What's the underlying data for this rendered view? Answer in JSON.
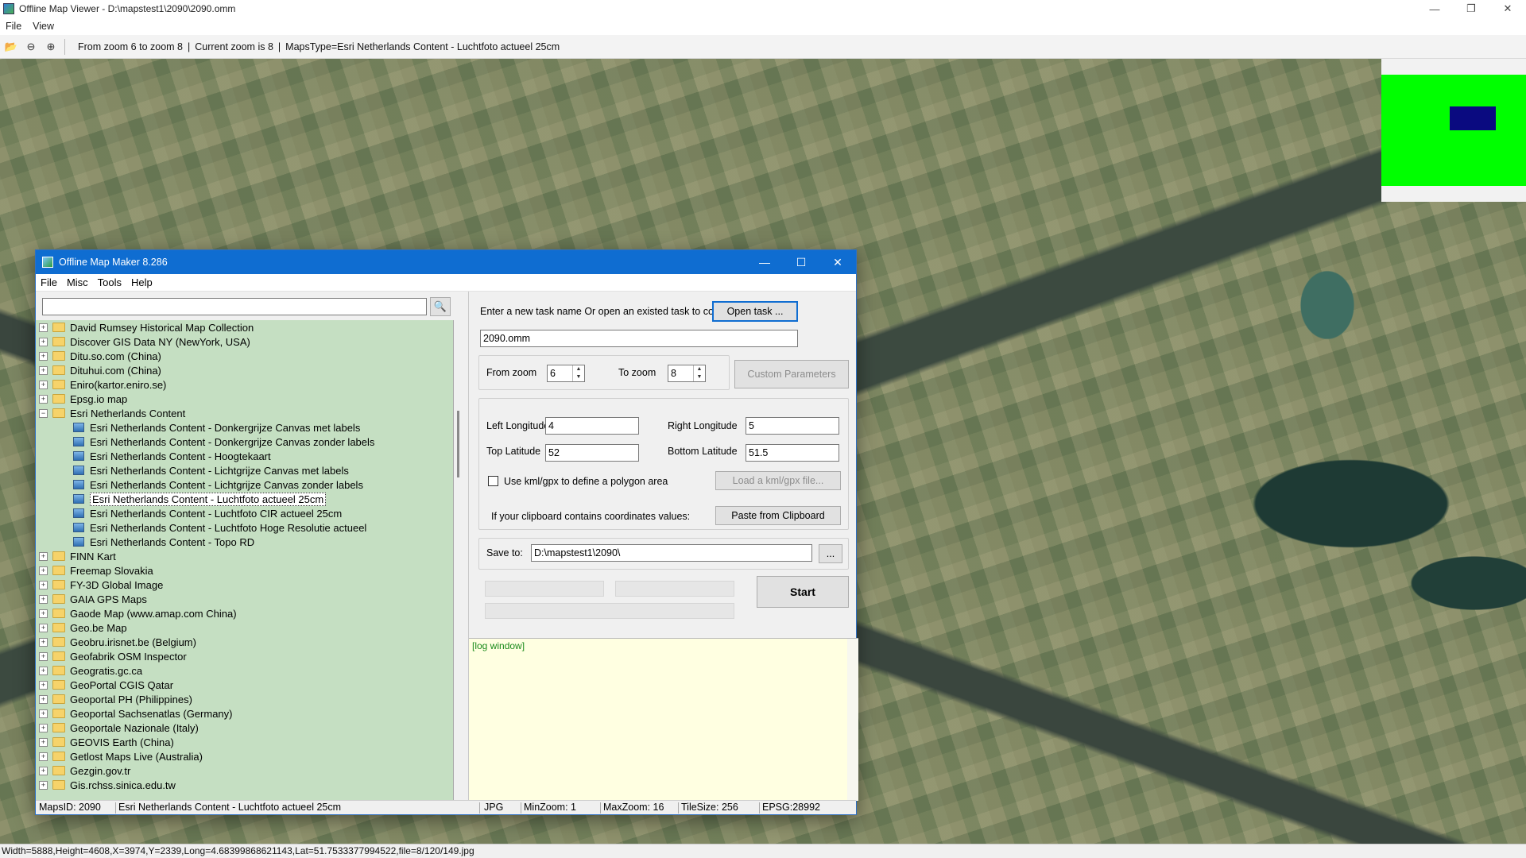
{
  "viewer": {
    "title": "Offline Map Viewer - D:\\mapstest1\\2090\\2090.omm",
    "menu": [
      "File",
      "View"
    ],
    "toolbar_info": {
      "zoom_range": "From zoom 6 to zoom 8",
      "current_zoom": "Current zoom is 8",
      "maps_type": "MapsType=Esri Netherlands Content - Luchtfoto actueel 25cm"
    },
    "status": "Width=5888,Height=4608,X=3974,Y=2339,Long=4.68399868621143,Lat=51.7533377994522,file=8/120/149.jpg",
    "minimap_colors": {
      "overview": "#00ff00",
      "viewport": "#0a0a80"
    }
  },
  "dialog": {
    "title": "Offline Map Maker 8.286",
    "menu": [
      "File",
      "Misc",
      "Tools",
      "Help"
    ],
    "search_value": "",
    "tree": [
      {
        "label": "David Rumsey Historical Map Collection",
        "type": "folder",
        "expanded": false
      },
      {
        "label": "Discover GIS Data NY (NewYork, USA)",
        "type": "folder",
        "expanded": false
      },
      {
        "label": "Ditu.so.com (China)",
        "type": "folder",
        "expanded": false
      },
      {
        "label": "Dituhui.com (China)",
        "type": "folder",
        "expanded": false
      },
      {
        "label": "Eniro(kartor.eniro.se)",
        "type": "folder",
        "expanded": false
      },
      {
        "label": "Epsg.io map",
        "type": "folder",
        "expanded": false
      },
      {
        "label": "Esri Netherlands Content",
        "type": "folder",
        "expanded": true
      },
      {
        "label": "Esri Netherlands Content - Donkergrijze Canvas met labels",
        "type": "map"
      },
      {
        "label": "Esri Netherlands Content - Donkergrijze Canvas zonder labels",
        "type": "map"
      },
      {
        "label": "Esri Netherlands Content - Hoogtekaart",
        "type": "map"
      },
      {
        "label": "Esri Netherlands Content - Lichtgrijze Canvas met labels",
        "type": "map"
      },
      {
        "label": "Esri Netherlands Content - Lichtgrijze Canvas zonder labels",
        "type": "map"
      },
      {
        "label": "Esri Netherlands Content - Luchtfoto actueel 25cm",
        "type": "map",
        "selected": true
      },
      {
        "label": "Esri Netherlands Content - Luchtfoto CIR actueel 25cm",
        "type": "map"
      },
      {
        "label": "Esri Netherlands Content - Luchtfoto Hoge Resolutie actueel",
        "type": "map"
      },
      {
        "label": "Esri Netherlands Content - Topo RD",
        "type": "map"
      },
      {
        "label": "FINN Kart",
        "type": "folder",
        "expanded": false
      },
      {
        "label": "Freemap Slovakia",
        "type": "folder",
        "expanded": false
      },
      {
        "label": "FY-3D Global Image",
        "type": "folder",
        "expanded": false
      },
      {
        "label": "GAIA GPS Maps",
        "type": "folder",
        "expanded": false
      },
      {
        "label": "Gaode Map (www.amap.com China)",
        "type": "folder",
        "expanded": false
      },
      {
        "label": "Geo.be Map",
        "type": "folder",
        "expanded": false
      },
      {
        "label": "Geobru.irisnet.be (Belgium)",
        "type": "folder",
        "expanded": false
      },
      {
        "label": "Geofabrik OSM Inspector",
        "type": "folder",
        "expanded": false
      },
      {
        "label": "Geogratis.gc.ca",
        "type": "folder",
        "expanded": false
      },
      {
        "label": "GeoPortal CGIS Qatar",
        "type": "folder",
        "expanded": false
      },
      {
        "label": "Geoportal PH (Philippines)",
        "type": "folder",
        "expanded": false
      },
      {
        "label": "Geoportal Sachsenatlas (Germany)",
        "type": "folder",
        "expanded": false
      },
      {
        "label": "Geoportale Nazionale (Italy)",
        "type": "folder",
        "expanded": false
      },
      {
        "label": "GEOVIS Earth (China)",
        "type": "folder",
        "expanded": false
      },
      {
        "label": "Getlost Maps Live (Australia)",
        "type": "folder",
        "expanded": false
      },
      {
        "label": "Gezgin.gov.tr",
        "type": "folder",
        "expanded": false
      },
      {
        "label": "Gis.rchss.sinica.edu.tw",
        "type": "folder",
        "expanded": false
      }
    ],
    "form": {
      "task_prompt": "Enter a new task name Or open an existed task to continue:",
      "open_task_label": "Open task ...",
      "task_name": "2090.omm",
      "from_zoom_label": "From zoom",
      "from_zoom": "6",
      "to_zoom_label": "To zoom",
      "to_zoom": "8",
      "custom_params_label": "Custom Parameters",
      "left_lon_label": "Left Longitude",
      "left_lon": "4",
      "right_lon_label": "Right Longitude",
      "right_lon": "5",
      "top_lat_label": "Top Latitude",
      "top_lat": "52",
      "bottom_lat_label": "Bottom Latitude",
      "bottom_lat": "51.5",
      "kml_checkbox_label": "Use kml/gpx to define a polygon area",
      "load_kml_label": "Load a kml/gpx file...",
      "clipboard_prompt": "If your clipboard contains coordinates values:",
      "paste_label": "Paste from Clipboard",
      "save_to_label": "Save to:",
      "save_to": "D:\\mapstest1\\2090\\",
      "browse_label": "...",
      "start_label": "Start",
      "log_text": "[log window]"
    },
    "status": {
      "maps_id": "MapsID: 2090",
      "map_name": "Esri Netherlands Content - Luchtfoto actueel 25cm",
      "format": "JPG",
      "min_zoom": "MinZoom: 1",
      "max_zoom": "MaxZoom: 16",
      "tile_size": "TileSize: 256",
      "epsg": "EPSG:28992"
    }
  }
}
